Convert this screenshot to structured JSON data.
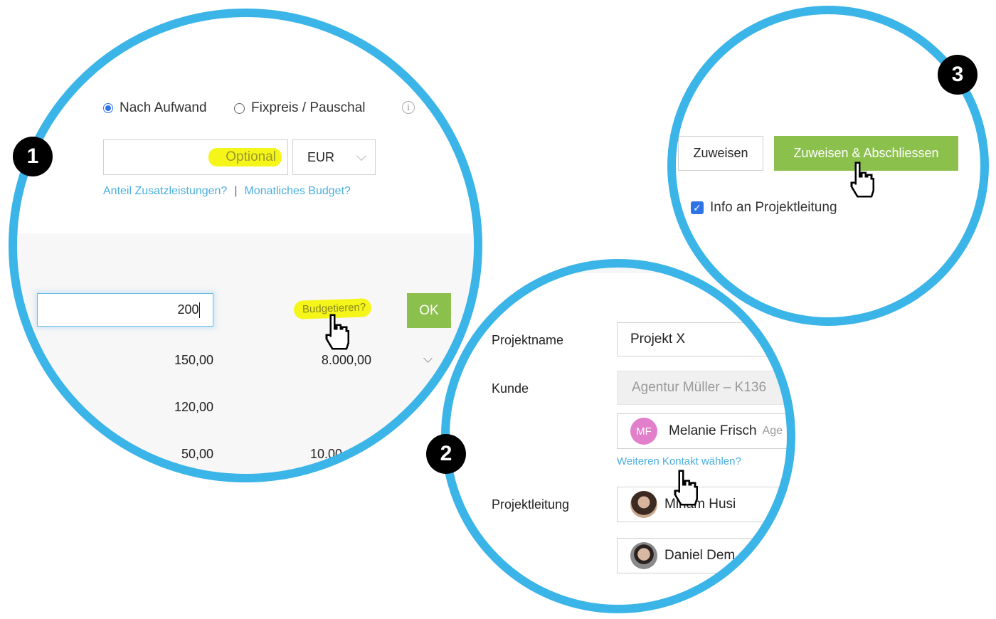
{
  "badges": [
    "1",
    "2",
    "3"
  ],
  "step1": {
    "billing_options": [
      {
        "label": "Nach Aufwand",
        "selected": true
      },
      {
        "label": "Fixpreis / Pauschal",
        "selected": false
      }
    ],
    "info_icon": "info-circle-icon",
    "budget_input": {
      "value": "",
      "placeholder": "Optional"
    },
    "currency_select": {
      "value": "EUR"
    },
    "links": {
      "extra_services": "Anteil Zusatzleistungen?",
      "separator": "|",
      "monthly_budget": "Monatliches Budget?"
    },
    "rate_input": {
      "value": "200"
    },
    "budget_link": "Budgetieren?",
    "ok_button": "OK",
    "rows": [
      {
        "rate": "150,00",
        "budget": "8.000,00",
        "has_chevron": true
      },
      {
        "rate": "120,00",
        "budget": "",
        "has_chevron": false
      },
      {
        "rate": "50,00",
        "budget": "10.00",
        "has_chevron": false
      }
    ]
  },
  "step2": {
    "project_name_label": "Projektname",
    "project_name_value": "Projekt X",
    "customer_label": "Kunde",
    "customer_value": "Agentur Müller – K136",
    "contact": {
      "initials": "MF",
      "name": "Melanie Frisch",
      "company_partial": "Age",
      "avatar_color": "#e27fcb"
    },
    "more_contact_link": "Weiteren Kontakt wählen?",
    "project_lead_label": "Projektleitung",
    "leads": [
      {
        "name": "Miriam Husi"
      },
      {
        "name": "Daniel Dem"
      }
    ]
  },
  "step3": {
    "assign_button": "Zuweisen",
    "assign_close_button": "Zuweisen & Abschliessen",
    "notify_checkbox": {
      "label": "Info an Projektleitung",
      "checked": true
    }
  },
  "colors": {
    "ring": "#3bb4e8",
    "accent_green": "#8bc04c",
    "link_blue": "#4aaee0",
    "highlight_yellow": "#f5f51a",
    "radio_blue": "#2f74e6"
  }
}
